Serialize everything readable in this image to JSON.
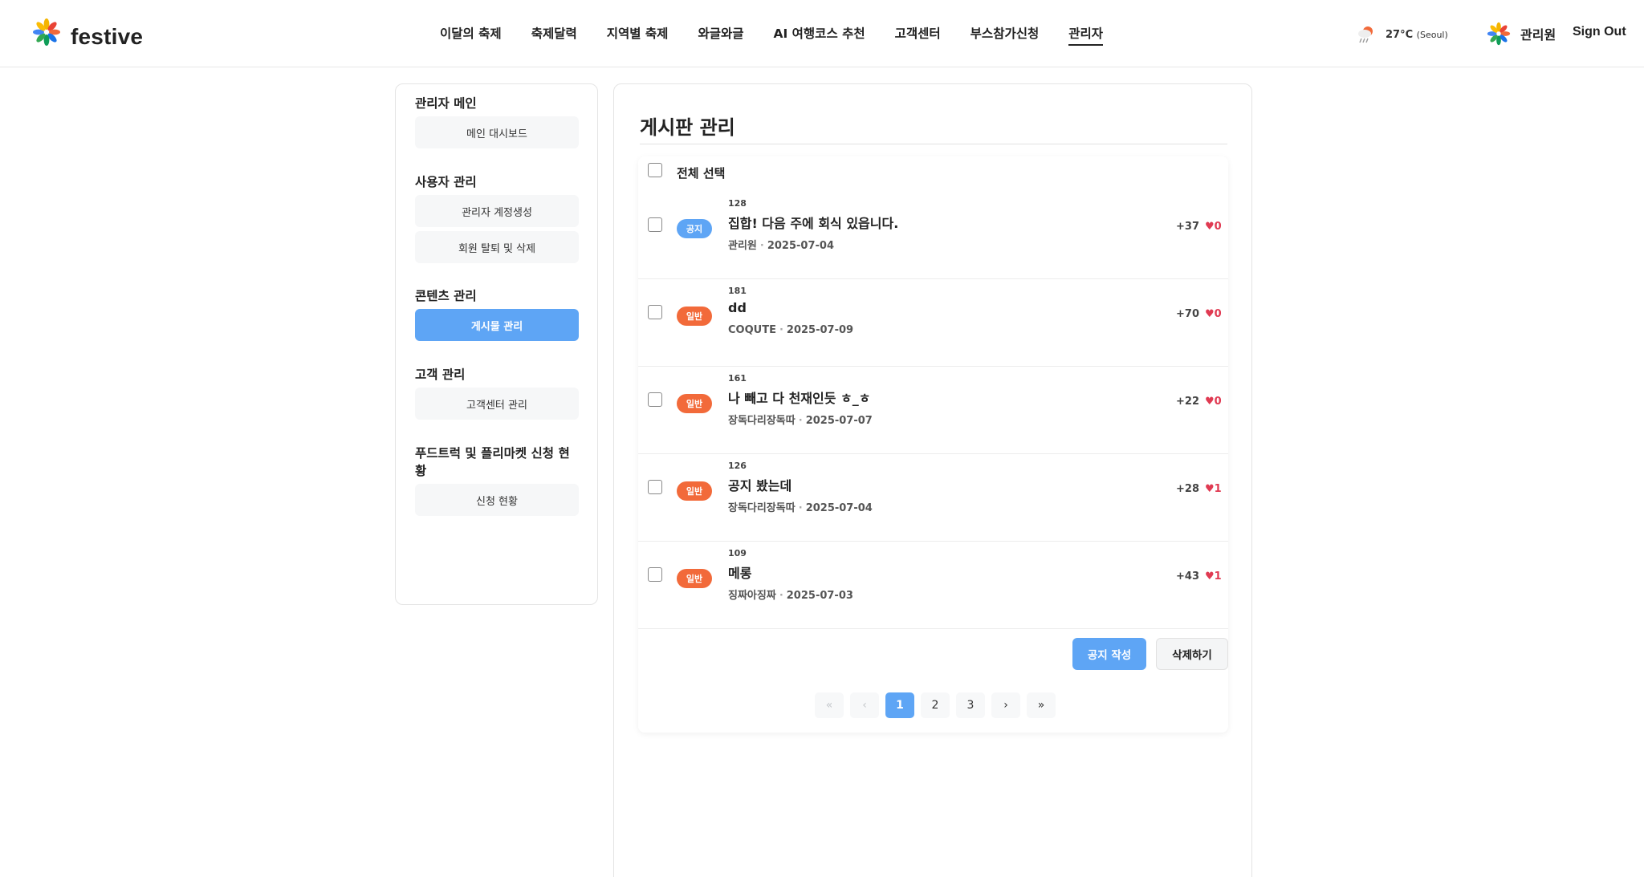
{
  "brand": {
    "name": "festive"
  },
  "nav": {
    "items": [
      {
        "label": "이달의 축제",
        "active": false
      },
      {
        "label": "축제달력",
        "active": false
      },
      {
        "label": "지역별 축제",
        "active": false
      },
      {
        "label": "와글와글",
        "active": false
      },
      {
        "label": "AI 여행코스 추천",
        "active": false
      },
      {
        "label": "고객센터",
        "active": false
      },
      {
        "label": "부스참가신청",
        "active": false
      },
      {
        "label": "관리자",
        "active": true
      }
    ]
  },
  "weather": {
    "temp": "27°C",
    "city": "(Seoul)",
    "icon": "cloud-rain-sun-icon"
  },
  "user": {
    "name": "관리원",
    "signout_label": "Sign Out"
  },
  "sidebar": {
    "sections": [
      {
        "title": "관리자 메인",
        "items": [
          {
            "label": "메인 대시보드",
            "active": false
          }
        ]
      },
      {
        "title": "사용자 관리",
        "items": [
          {
            "label": "관리자 계정생성",
            "active": false
          },
          {
            "label": "회원 탈퇴 및 삭제",
            "active": false
          }
        ]
      },
      {
        "title": "콘텐츠 관리",
        "items": [
          {
            "label": "게시물 관리",
            "active": true
          }
        ]
      },
      {
        "title": "고객 관리",
        "items": [
          {
            "label": "고객센터 관리",
            "active": false
          }
        ]
      },
      {
        "title": "푸드트럭 및 플리마켓 신청 현황",
        "items": [
          {
            "label": "신청 현황",
            "active": false
          }
        ]
      }
    ]
  },
  "main": {
    "title": "게시판 관리",
    "select_all_label": "전체 선택",
    "posts": [
      {
        "no": "128",
        "badge": "공지",
        "type": "notice",
        "title": "집합! 다음 주에 회식 있읍니다.",
        "author": "관리원",
        "date": "2025-07-04",
        "views": "+37",
        "likes": "♥0"
      },
      {
        "no": "181",
        "badge": "일반",
        "type": "normal",
        "title": "dd",
        "author": "COQUTE",
        "date": "2025-07-09",
        "views": "+70",
        "likes": "♥0"
      },
      {
        "no": "161",
        "badge": "일반",
        "type": "normal",
        "title": "나 빼고 다 천재인듯 ㅎ_ㅎ",
        "author": "장독다리장독따",
        "date": "2025-07-07",
        "views": "+22",
        "likes": "♥0"
      },
      {
        "no": "126",
        "badge": "일반",
        "type": "normal",
        "title": "공지 봤는데",
        "author": "장독다리장독따",
        "date": "2025-07-04",
        "views": "+28",
        "likes": "♥1"
      },
      {
        "no": "109",
        "badge": "일반",
        "type": "normal",
        "title": "메롱",
        "author": "징짜아징짜",
        "date": "2025-07-03",
        "views": "+43",
        "likes": "♥1"
      }
    ],
    "actions": {
      "write_notice": "공지 작성",
      "delete": "삭제하기"
    },
    "pagination": {
      "first": "«",
      "prev": "‹",
      "pages": [
        "1",
        "2",
        "3"
      ],
      "current": "1",
      "next": "›",
      "last": "»"
    }
  },
  "colors": {
    "accent": "#5ea5f5",
    "notice_badge": "#5ea5f5",
    "normal_badge": "#f26a3a",
    "like": "#e03a52"
  }
}
